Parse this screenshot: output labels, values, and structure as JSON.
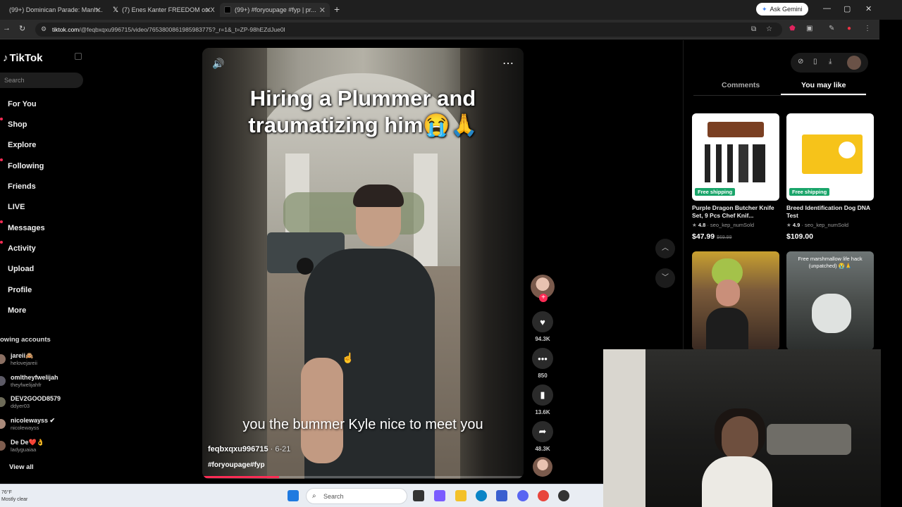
{
  "browser": {
    "tabs": [
      {
        "label": "(99+) Dominican Parade: Manh..."
      },
      {
        "label": "(7) Enes Kanter FREEDOM on X"
      },
      {
        "label": "(99+) #foryoupage #fyp | pr..."
      }
    ],
    "gemini_label": "Ask Gemini",
    "url_host": "tiktok.com",
    "url_path": "/@feqbxqxu996715/video/7653800861985983775?_r=1&_t=ZP-98hEZdJue0l"
  },
  "sidebar": {
    "logo": "TikTok",
    "search_placeholder": "Search",
    "nav": [
      {
        "label": "For You"
      },
      {
        "label": "Shop"
      },
      {
        "label": "Explore"
      },
      {
        "label": "Following"
      },
      {
        "label": "Friends"
      },
      {
        "label": "LIVE"
      },
      {
        "label": "Messages"
      },
      {
        "label": "Activity"
      },
      {
        "label": "Upload"
      },
      {
        "label": "Profile"
      },
      {
        "label": "More"
      }
    ],
    "following_title": "owing accounts",
    "accounts": [
      {
        "name": "jareii🙈",
        "handle": "helovejareii"
      },
      {
        "name": "omltheyfwelijah",
        "handle": "theyfwelijahfr"
      },
      {
        "name": "DEV2GOOD8579",
        "handle": "ddyer03"
      },
      {
        "name": "nicolewayss ✔",
        "handle": "nicolewayss"
      },
      {
        "name": "De De❤️👌",
        "handle": "ladyguaiaa"
      }
    ],
    "view_all": "View all"
  },
  "video": {
    "title_line1": "Hiring a Plummer and",
    "title_line2": "traumatizing him😭🙏",
    "subtitle": "you the bummer Kyle nice to meet you",
    "author": "feqbxqxu996715",
    "date": " · 6-21",
    "hashtags": "#foryoupage#fyp",
    "progress": 0.24
  },
  "actions": {
    "likes": "94.3K",
    "comments": "850",
    "saves": "13.6K",
    "shares": "48.3K"
  },
  "panel": {
    "tab_comments": "Comments",
    "tab_you_may_like": "You may like",
    "products": [
      {
        "title": "Purple Dragon Butcher Knife Set, 9 Pcs Chef Knif...",
        "rating": "4.8",
        "seller": "· seo_kep_numSold",
        "price": "$47.99",
        "old_price": "$69.99",
        "badge": "Free shipping"
      },
      {
        "title": "Breed Identification Dog DNA Test",
        "rating": "4.9",
        "seller": "· seo_kep_numSold",
        "price": "$109.00",
        "old_price": "",
        "badge": "Free shipping"
      }
    ],
    "thumb2_caption": "Free marshmallow life hack (unpatched) 😭🙏"
  },
  "taskbar": {
    "weather_temp": "76°F",
    "weather_desc": "Mostly clear",
    "search_label": "Search"
  }
}
